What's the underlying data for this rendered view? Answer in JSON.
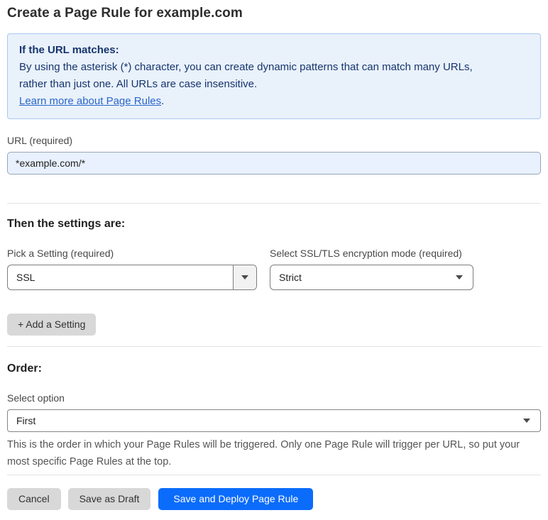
{
  "page": {
    "title": "Create a Page Rule for example.com"
  },
  "info_box": {
    "heading": "If the URL matches:",
    "body_lines": [
      "By using the asterisk (*) character, you can create dynamic patterns that can match many URLs,",
      "rather than just one. All URLs are case insensitive."
    ],
    "link_label": "Learn more about Page Rules",
    "link_suffix": "."
  },
  "url_field": {
    "label": "URL (required)",
    "value": "*example.com/*"
  },
  "settings_section": {
    "heading": "Then the settings are:",
    "pick_setting": {
      "label": "Pick a Setting (required)",
      "value": "SSL"
    },
    "encryption_mode": {
      "label": "Select SSL/TLS encryption mode (required)",
      "value": "Strict"
    },
    "add_setting_label": "+ Add a Setting"
  },
  "order_section": {
    "heading": "Order:",
    "select_label": "Select option",
    "value": "First",
    "help_lines": [
      "This is the order in which your Page Rules will be triggered. Only one Page Rule will trigger per URL, so put your",
      "most specific Page Rules at the top."
    ]
  },
  "footer": {
    "cancel_label": "Cancel",
    "save_draft_label": "Save as Draft",
    "save_deploy_label": "Save and Deploy Page Rule"
  },
  "colors": {
    "accent_blue": "#0b6cfb",
    "info_bg": "#e9f1fb",
    "info_border": "#a9c8ef",
    "info_text": "#16356d",
    "link_blue": "#2a66c9",
    "input_bg": "#e8f1fd"
  },
  "icons": {
    "dropdown_caret": "chevron-down-icon"
  }
}
